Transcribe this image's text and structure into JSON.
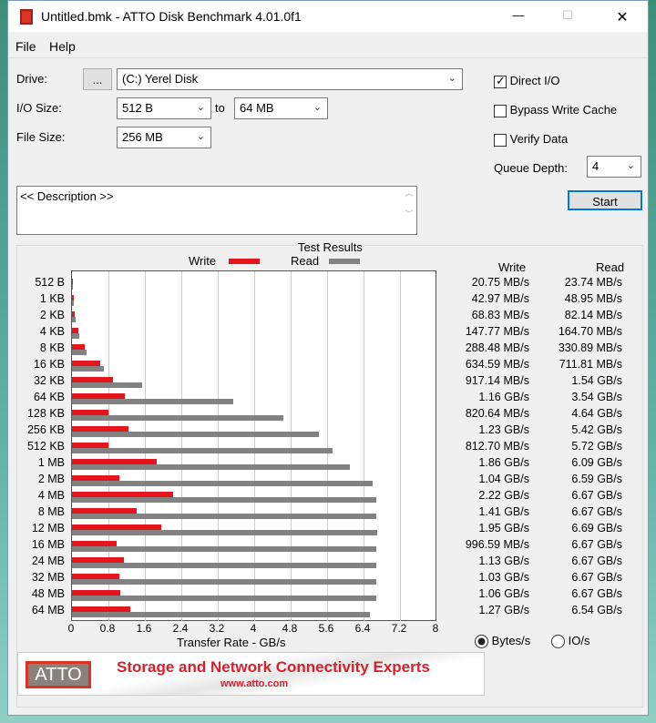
{
  "window": {
    "title": "Untitled.bmk - ATTO Disk Benchmark 4.01.0f1",
    "minimize": "—",
    "maximize": "☐",
    "close": "✕"
  },
  "menu": [
    "File",
    "Help"
  ],
  "settings": {
    "drive_label": "Drive:",
    "browse_label": "...",
    "drive_value": "(C:) Yerel Disk",
    "io_size_label": "I/O Size:",
    "io_from": "512 B",
    "to_label": "to",
    "io_to": "64 MB",
    "file_size_label": "File Size:",
    "file_size": "256 MB",
    "direct_io": {
      "label": "Direct I/O",
      "checked": true
    },
    "bypass_write_cache": {
      "label": "Bypass Write Cache",
      "checked": false
    },
    "verify_data": {
      "label": "Verify Data",
      "checked": false
    },
    "queue_depth_label": "Queue Depth:",
    "queue_depth": "4",
    "start_label": "Start",
    "description": "<< Description >>"
  },
  "results": {
    "title": "Test Results",
    "legend_write": "Write",
    "legend_read": "Read",
    "col_write": "Write",
    "col_read": "Read",
    "rows": [
      {
        "size": "512 B",
        "write": "20.75 MB/s",
        "read": "23.74 MB/s"
      },
      {
        "size": "1 KB",
        "write": "42.97 MB/s",
        "read": "48.95 MB/s"
      },
      {
        "size": "2 KB",
        "write": "68.83 MB/s",
        "read": "82.14 MB/s"
      },
      {
        "size": "4 KB",
        "write": "147.77 MB/s",
        "read": "164.70 MB/s"
      },
      {
        "size": "8 KB",
        "write": "288.48 MB/s",
        "read": "330.89 MB/s"
      },
      {
        "size": "16 KB",
        "write": "634.59 MB/s",
        "read": "711.81 MB/s"
      },
      {
        "size": "32 KB",
        "write": "917.14 MB/s",
        "read": "1.54 GB/s"
      },
      {
        "size": "64 KB",
        "write": "1.16 GB/s",
        "read": "3.54 GB/s"
      },
      {
        "size": "128 KB",
        "write": "820.64 MB/s",
        "read": "4.64 GB/s"
      },
      {
        "size": "256 KB",
        "write": "1.23 GB/s",
        "read": "5.42 GB/s"
      },
      {
        "size": "512 KB",
        "write": "812.70 MB/s",
        "read": "5.72 GB/s"
      },
      {
        "size": "1 MB",
        "write": "1.86 GB/s",
        "read": "6.09 GB/s"
      },
      {
        "size": "2 MB",
        "write": "1.04 GB/s",
        "read": "6.59 GB/s"
      },
      {
        "size": "4 MB",
        "write": "2.22 GB/s",
        "read": "6.67 GB/s"
      },
      {
        "size": "8 MB",
        "write": "1.41 GB/s",
        "read": "6.67 GB/s"
      },
      {
        "size": "12 MB",
        "write": "1.95 GB/s",
        "read": "6.69 GB/s"
      },
      {
        "size": "16 MB",
        "write": "996.59 MB/s",
        "read": "6.67 GB/s"
      },
      {
        "size": "24 MB",
        "write": "1.13 GB/s",
        "read": "6.67 GB/s"
      },
      {
        "size": "32 MB",
        "write": "1.03 GB/s",
        "read": "6.67 GB/s"
      },
      {
        "size": "48 MB",
        "write": "1.06 GB/s",
        "read": "6.67 GB/s"
      },
      {
        "size": "64 MB",
        "write": "1.27 GB/s",
        "read": "6.54 GB/s"
      }
    ],
    "units": {
      "bytes_label": "Bytes/s",
      "bytes_selected": true,
      "io_label": "IO/s",
      "io_selected": false
    }
  },
  "chart_data": {
    "type": "bar",
    "orientation": "horizontal",
    "categories": [
      "512 B",
      "1 KB",
      "2 KB",
      "4 KB",
      "8 KB",
      "16 KB",
      "32 KB",
      "64 KB",
      "128 KB",
      "256 KB",
      "512 KB",
      "1 MB",
      "2 MB",
      "4 MB",
      "8 MB",
      "12 MB",
      "16 MB",
      "24 MB",
      "32 MB",
      "48 MB",
      "64 MB"
    ],
    "series": [
      {
        "name": "Write",
        "color": "#e8141b",
        "values": [
          0.02,
          0.042,
          0.067,
          0.144,
          0.282,
          0.62,
          0.896,
          1.16,
          0.801,
          1.23,
          0.794,
          1.86,
          1.04,
          2.22,
          1.41,
          1.95,
          0.973,
          1.13,
          1.03,
          1.06,
          1.27
        ]
      },
      {
        "name": "Read",
        "color": "#828282",
        "values": [
          0.023,
          0.048,
          0.08,
          0.161,
          0.323,
          0.695,
          1.54,
          3.54,
          4.64,
          5.42,
          5.72,
          6.09,
          6.59,
          6.67,
          6.67,
          6.69,
          6.67,
          6.67,
          6.67,
          6.67,
          6.54
        ]
      }
    ],
    "xlabel": "Transfer Rate - GB/s",
    "xlim": [
      0,
      8
    ],
    "xticks": [
      "0",
      "0.8",
      "1.6",
      "2.4",
      "3.2",
      "4",
      "4.8",
      "5.6",
      "6.4",
      "7.2",
      "8"
    ],
    "grid": true
  },
  "banner": {
    "logo": "ATTO",
    "tagline": "Storage and Network Connectivity Experts",
    "url": "www.atto.com"
  }
}
